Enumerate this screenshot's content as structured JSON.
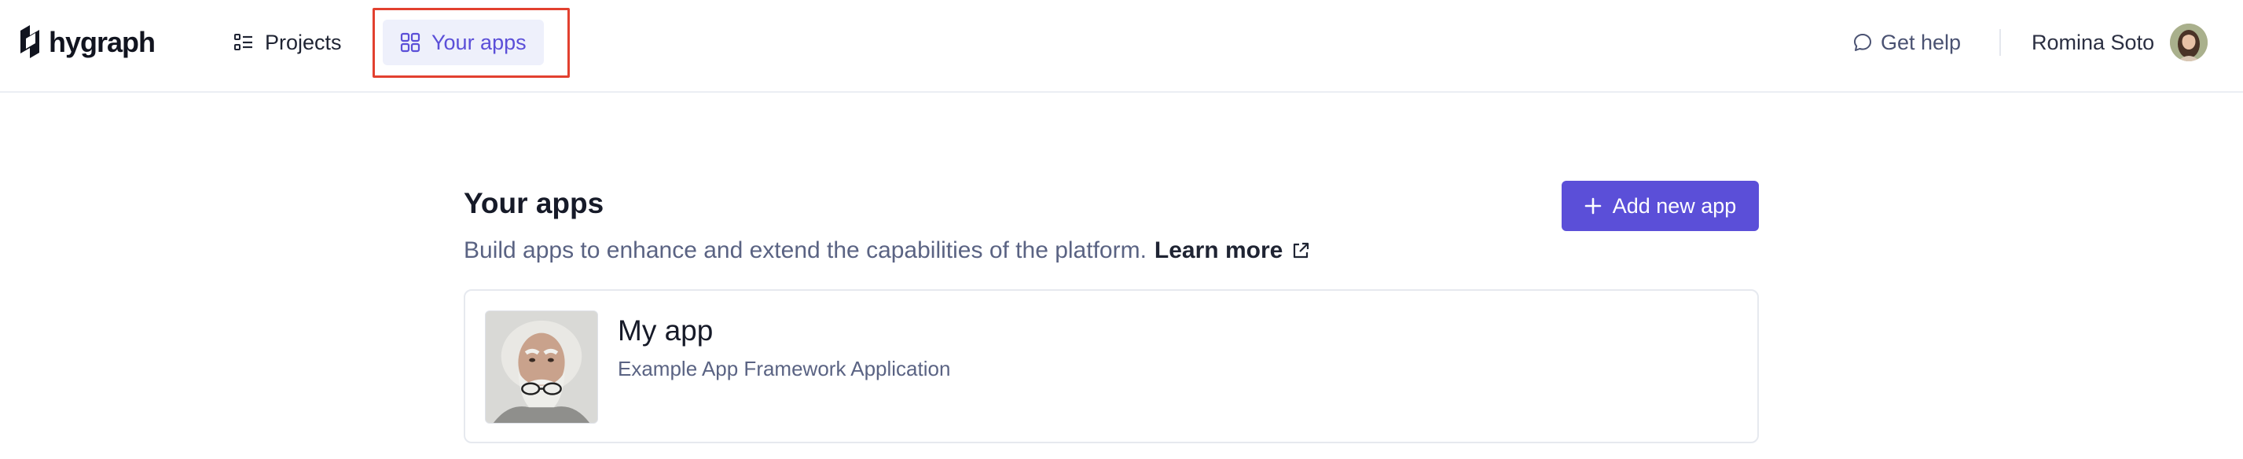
{
  "brand": {
    "name": "hygraph"
  },
  "nav": {
    "projects_label": "Projects",
    "apps_label": "Your apps",
    "active": "Your apps"
  },
  "header_right": {
    "help_label": "Get help",
    "user_name": "Romina Soto"
  },
  "page": {
    "title": "Your apps",
    "subtitle": "Build apps to enhance and extend the capabilities of the platform.",
    "learn_more_label": "Learn more",
    "add_button_label": "Add new app"
  },
  "apps": [
    {
      "name": "My app",
      "description": "Example App Framework Application"
    }
  ],
  "colors": {
    "accent": "#5b4fd8",
    "accent_bg": "#eef0fb",
    "highlight_outline": "#e2402f",
    "muted_text": "#5a6383"
  },
  "icons": {
    "projects": "list-icon",
    "apps": "grid-icon",
    "help": "chat-bubble-icon",
    "add": "plus-icon",
    "learn_more": "external-link-icon"
  }
}
